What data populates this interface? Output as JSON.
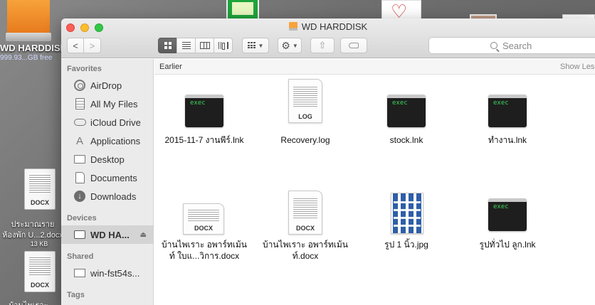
{
  "desktop": {
    "drive_name": "WD HARDDISK",
    "drive_size": "999.93...GB free",
    "file1_tag": "DOCX",
    "file1_name_line1": "ประมาณราย",
    "file1_name_line2": "ห้องพัก U...2.docx",
    "file1_size": "13 KB",
    "file2_tag": "DOCX",
    "file2_name": "บ้านไพเราะ ..."
  },
  "window": {
    "title": "WD HARDDISK",
    "nav_back": "<",
    "nav_forward": ">",
    "action_glyph": "⚙",
    "share_glyph": "⇧",
    "search_placeholder": "Search"
  },
  "sidebar": {
    "favorites_header": "Favorites",
    "favorites": [
      {
        "label": "AirDrop",
        "icon": "airdrop-icon"
      },
      {
        "label": "All My Files",
        "icon": "all-my-files-icon"
      },
      {
        "label": "iCloud Drive",
        "icon": "icloud-icon"
      },
      {
        "label": "Applications",
        "icon": "applications-icon"
      },
      {
        "label": "Desktop",
        "icon": "desktop-icon"
      },
      {
        "label": "Documents",
        "icon": "documents-icon"
      },
      {
        "label": "Downloads",
        "icon": "downloads-icon"
      }
    ],
    "devices_header": "Devices",
    "device_label": "WD HA...",
    "eject_glyph": "⏏",
    "shared_header": "Shared",
    "shared_label": "win-fst54s...",
    "tags_header": "Tags"
  },
  "main": {
    "group_title": "Earlier",
    "show_less": "Show Less",
    "items": [
      {
        "name": "2015-11-7 งานพีร์.lnk",
        "kind": "exec",
        "badge": "exec"
      },
      {
        "name": "Recovery.log",
        "kind": "doc",
        "badge": "LOG"
      },
      {
        "name": "stock.lnk",
        "kind": "exec",
        "badge": "exec"
      },
      {
        "name": "ทำงาน.lnk",
        "kind": "exec",
        "badge": "exec"
      },
      {
        "name_line1": "บ้านไพเราะ อพาร์ทเม้น",
        "name_line2": "ท์     ใบแ...วิการ.docx",
        "kind": "doc-wide",
        "badge": "DOCX"
      },
      {
        "name_line1": "บ้านไพเราะ อพาร์ทเม้น",
        "name_line2": "ท์.docx",
        "kind": "doc",
        "badge": "DOCX"
      },
      {
        "name": "รูป 1 นิ้ว.jpg",
        "kind": "jpg"
      },
      {
        "name": "รูปทั่วไป ลูก.lnk",
        "kind": "exec",
        "badge": "exec"
      }
    ]
  },
  "colors": {
    "close": "#fc5f57",
    "minimize": "#fdbc2e",
    "maximize": "#33c748",
    "exec_text": "#3ad45a",
    "sidebar_bg": "#ebebeb"
  }
}
